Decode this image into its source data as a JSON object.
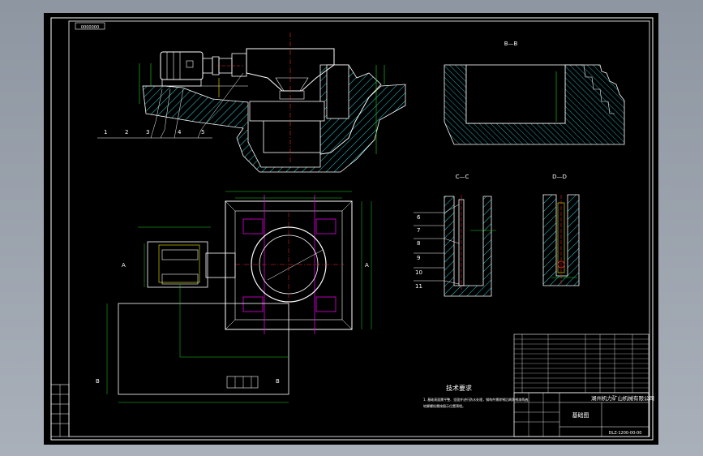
{
  "colors": {
    "background": "#9aa2ac",
    "paper": "#000000",
    "line": "#ffffff",
    "hatch": "#2fd0d8",
    "dimension": "#1fd31f",
    "centerline": "#ff2a2a",
    "magenta": "#e000e0",
    "yellow": "#f0f000"
  },
  "drawing": {
    "corner_tag": "0000000",
    "section_bb": "B—B",
    "section_cc": "C—C",
    "section_dd": "D—D",
    "section_marks": [
      "A",
      "A",
      "B",
      "B"
    ],
    "callouts_left": [
      "1",
      "2",
      "3",
      "4",
      "5"
    ],
    "callouts_cc": [
      "6",
      "7",
      "8",
      "9",
      "10",
      "11"
    ],
    "tech_title": "技术要求",
    "tech_text_line1": "1. 基础表面需平整、坚固并进行防水处理，钢构件需除锈后刷防锈漆两遍；",
    "tech_text_line2": "   地脚螺栓需按图示位置预埋。",
    "company": "湖州机力矿山机械有限公司",
    "drawing_name": "基础图",
    "drawing_no": "DLZ-1200-00-00"
  }
}
